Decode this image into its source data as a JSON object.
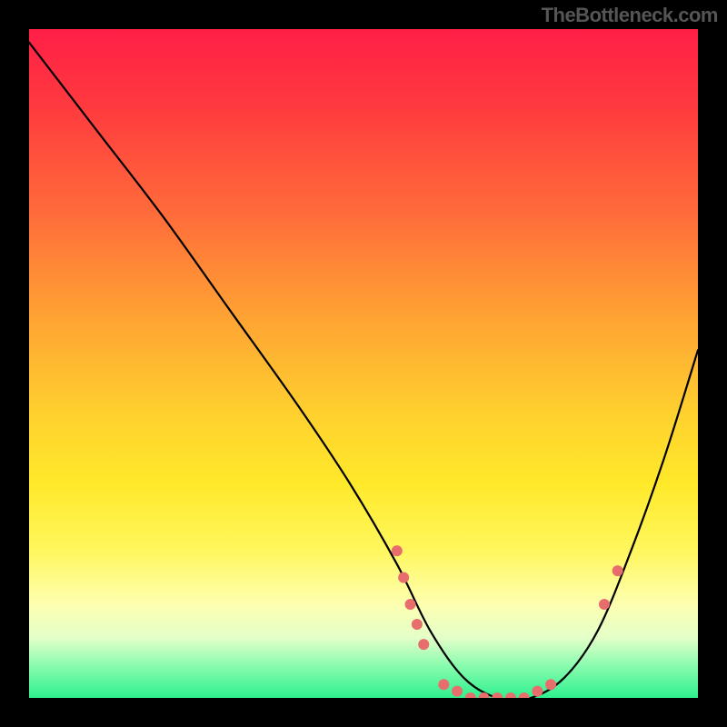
{
  "watermark": "TheBottleneck.com",
  "gradient_colors": {
    "top": "#ff1f47",
    "upper_mid": "#ffa633",
    "mid": "#ffe92a",
    "lower_mid": "#fdffb0",
    "bottom": "#2ef08e"
  },
  "chart_data": {
    "type": "line",
    "title": "",
    "xlabel": "",
    "ylabel": "",
    "xlim": [
      0,
      100
    ],
    "ylim": [
      0,
      100
    ],
    "note": "Values are estimated from pixel positions; no axis tick labels are visible in the image.",
    "series": [
      {
        "name": "bottleneck-curve",
        "x": [
          0,
          10,
          20,
          30,
          40,
          48,
          55,
          60,
          65,
          70,
          75,
          80,
          85,
          90,
          95,
          100
        ],
        "y": [
          98,
          85,
          72,
          58,
          44,
          32,
          20,
          10,
          3,
          0,
          0,
          3,
          10,
          22,
          36,
          52
        ]
      }
    ],
    "markers": {
      "name": "highlight-dots",
      "color": "#e86d6d",
      "points": [
        {
          "x": 55,
          "y": 22
        },
        {
          "x": 56,
          "y": 18
        },
        {
          "x": 57,
          "y": 14
        },
        {
          "x": 58,
          "y": 11
        },
        {
          "x": 59,
          "y": 8
        },
        {
          "x": 62,
          "y": 2
        },
        {
          "x": 64,
          "y": 1
        },
        {
          "x": 66,
          "y": 0
        },
        {
          "x": 68,
          "y": 0
        },
        {
          "x": 70,
          "y": 0
        },
        {
          "x": 72,
          "y": 0
        },
        {
          "x": 74,
          "y": 0
        },
        {
          "x": 76,
          "y": 1
        },
        {
          "x": 78,
          "y": 2
        },
        {
          "x": 86,
          "y": 14
        },
        {
          "x": 88,
          "y": 19
        }
      ]
    }
  }
}
